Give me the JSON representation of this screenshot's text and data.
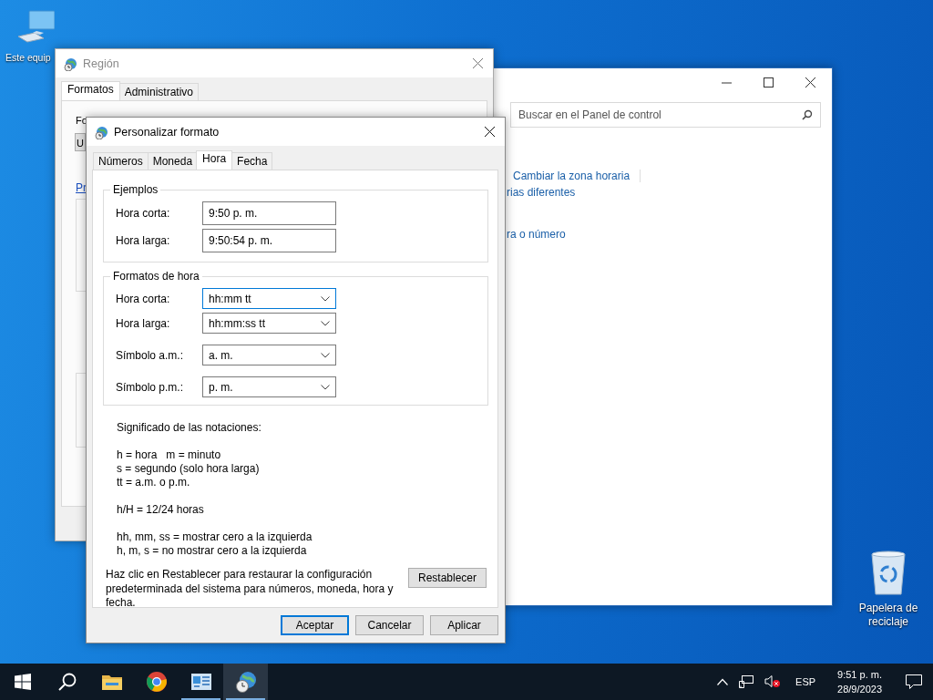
{
  "desktop_icons": [
    {
      "kind": "computer",
      "label": "Este equip"
    },
    {
      "kind": "recycle-bin",
      "label": "Papelera de reciclaje"
    }
  ],
  "control_panel_window": {
    "search": {
      "placeholder": "Buscar en el Panel de control"
    },
    "links": [
      "Cambiar la zona horaria",
      "rias diferentes",
      "ra o número"
    ]
  },
  "region_window": {
    "title": "Región",
    "tabs": [
      {
        "label": "Formatos",
        "selected": true
      },
      {
        "label": "Administrativo",
        "selected": false
      }
    ],
    "fragments": {
      "label": "Fo",
      "dropdown": "U",
      "link": "Pr"
    }
  },
  "dialog": {
    "title": "Personalizar formato",
    "tabs": [
      {
        "label": "Números",
        "selected": false
      },
      {
        "label": "Moneda",
        "selected": false
      },
      {
        "label": "Hora",
        "selected": true
      },
      {
        "label": "Fecha",
        "selected": false
      }
    ],
    "examples": {
      "title": "Ejemplos",
      "rows": [
        {
          "label": "Hora corta:",
          "value": "9:50 p. m."
        },
        {
          "label": "Hora larga:",
          "value": "9:50:54 p. m."
        }
      ]
    },
    "formats": {
      "title": "Formatos de hora",
      "rows": [
        {
          "label": "Hora corta:",
          "value": "hh:mm tt",
          "focused": true
        },
        {
          "label": "Hora larga:",
          "value": "hh:mm:ss tt",
          "focused": false
        },
        {
          "label": "Símbolo a.m.:",
          "value": "a. m.",
          "focused": false
        },
        {
          "label": "Símbolo p.m.:",
          "value": "p. m.",
          "focused": false
        }
      ]
    },
    "notes": [
      [
        "Significado de las notaciones:"
      ],
      [
        "h = hora   m = minuto",
        "s = segundo (solo hora larga)",
        "tt = a.m. o p.m."
      ],
      [
        "h/H = 12/24 horas"
      ],
      [
        "hh, mm, ss = mostrar cero a la izquierda",
        "h, m, s = no mostrar cero a la izquierda"
      ]
    ],
    "reset": {
      "text": "Haz clic en Restablecer para restaurar la configuración predeterminada del sistema para números, moneda, hora y fecha.",
      "button": "Restablecer"
    },
    "buttons": [
      {
        "label": "Aceptar",
        "default": true
      },
      {
        "label": "Cancelar",
        "default": false
      },
      {
        "label": "Aplicar",
        "default": false
      }
    ]
  },
  "taskbar": {
    "apps": [
      {
        "kind": "start",
        "open": false,
        "active": false
      },
      {
        "kind": "search",
        "open": false,
        "active": false
      },
      {
        "kind": "folder",
        "open": false,
        "active": false
      },
      {
        "kind": "browser",
        "open": false,
        "active": false
      },
      {
        "kind": "control-panel",
        "open": true,
        "active": false
      },
      {
        "kind": "region",
        "open": true,
        "active": true
      }
    ],
    "language": "ESP",
    "time": "9:51 p. m.",
    "date": "28/9/2023"
  }
}
